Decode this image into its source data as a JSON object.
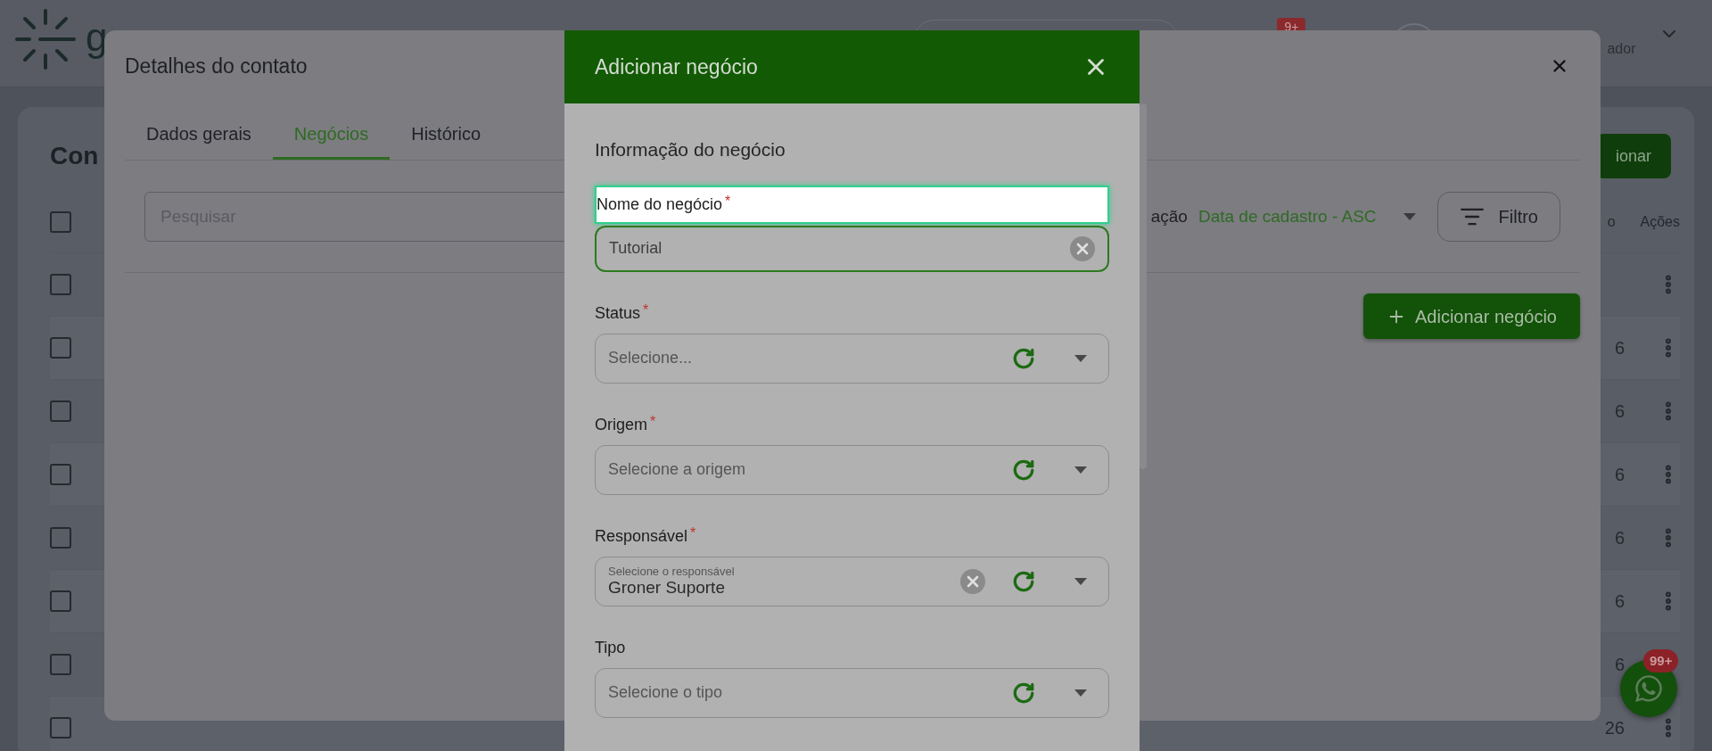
{
  "topbar": {
    "logo_text": "g",
    "notification_badge": "9+",
    "user_role": "ador"
  },
  "page": {
    "title": "Con",
    "add_button": "ionar",
    "table": {
      "select_all_checked": false,
      "columns": [
        {
          "label": "o"
        },
        {
          "label": "Ações"
        }
      ],
      "rows": [
        {
          "checked": false
        },
        {
          "checked": false,
          "date": "6"
        },
        {
          "checked": false,
          "date": "6"
        },
        {
          "checked": false,
          "date": "6"
        },
        {
          "checked": false,
          "date": "6"
        },
        {
          "checked": false,
          "date": "6"
        },
        {
          "checked": false,
          "date": "6"
        },
        {
          "checked": false,
          "date": "26"
        }
      ]
    }
  },
  "contact_modal": {
    "title": "Detalhes do contato",
    "tabs": [
      {
        "label": "Dados gerais",
        "selected": false
      },
      {
        "label": "Negócios",
        "selected": true
      },
      {
        "label": "Histórico",
        "selected": false
      }
    ],
    "search": {
      "placeholder": "Pesquisar"
    },
    "sort": {
      "label": "ação",
      "value": "Data de cadastro - ASC"
    },
    "filter_button": "Filtro",
    "add_deal_button": "Adicionar negócio"
  },
  "deal_drawer": {
    "title": "Adicionar negócio",
    "section": "Informação do negócio",
    "fields": [
      {
        "kind": "text",
        "label": "Nome do negócio",
        "required_mark": "*",
        "highlighted": true,
        "focused": true,
        "value": "Tutorial"
      },
      {
        "kind": "select",
        "label": "Status",
        "required_mark": "*",
        "highlighted": false,
        "focused": false,
        "placeholder": "Selecione..."
      },
      {
        "kind": "select",
        "label": "Origem",
        "required_mark": "*",
        "highlighted": false,
        "focused": false,
        "placeholder": "Selecione a origem"
      },
      {
        "kind": "select",
        "label": "Responsável",
        "required_mark": "*",
        "highlighted": false,
        "focused": false,
        "floating_label": "Selecione o responsável",
        "value": "Groner Suporte"
      },
      {
        "kind": "select",
        "label": "Tipo",
        "highlighted": false,
        "focused": false,
        "placeholder": "Selecione o tipo"
      }
    ]
  },
  "chat_fab": {
    "badge": "99+"
  }
}
